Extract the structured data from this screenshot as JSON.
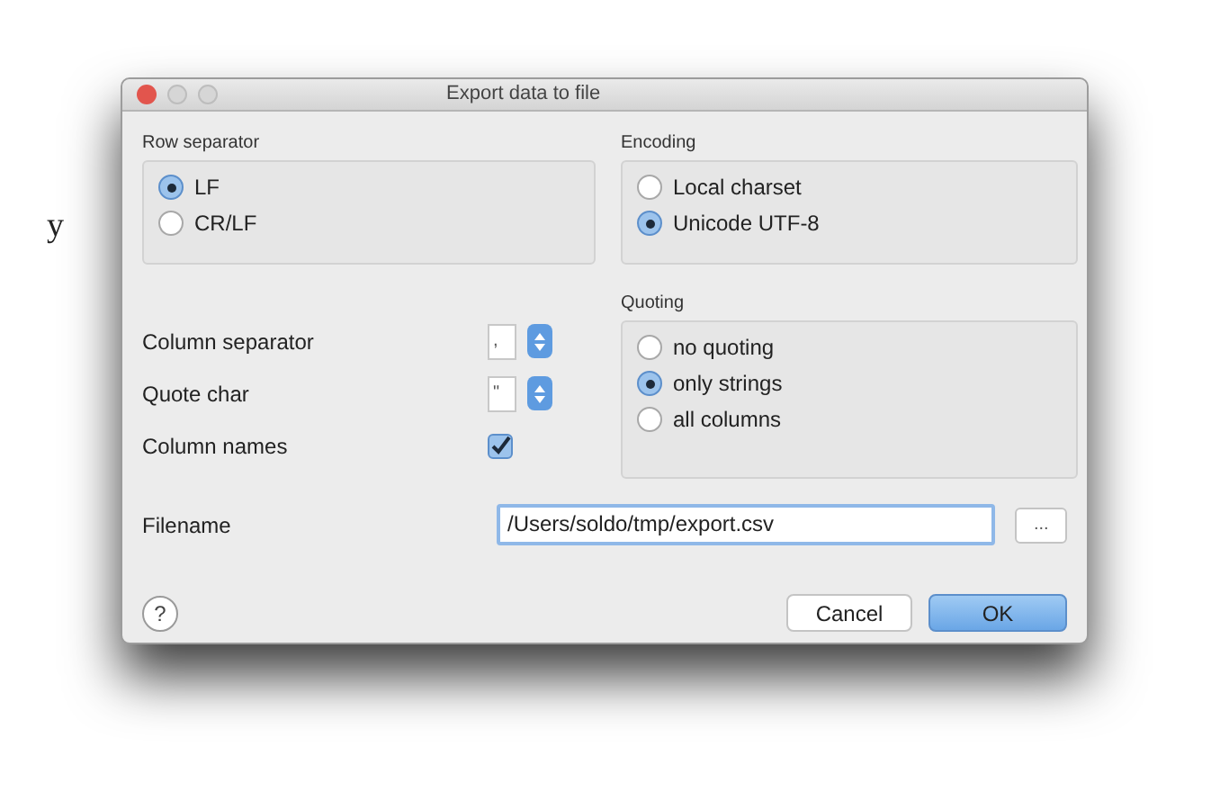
{
  "background_text": "y",
  "window": {
    "title": "Export data to file"
  },
  "row_separator": {
    "label": "Row separator",
    "options": [
      {
        "label": "LF",
        "selected": true
      },
      {
        "label": "CR/LF",
        "selected": false
      }
    ]
  },
  "encoding": {
    "label": "Encoding",
    "options": [
      {
        "label": "Local charset",
        "selected": false
      },
      {
        "label": "Unicode UTF-8",
        "selected": true
      }
    ]
  },
  "column_separator": {
    "label": "Column separator",
    "value": ","
  },
  "quote_char": {
    "label": "Quote char",
    "value": "\""
  },
  "column_names": {
    "label": "Column names",
    "checked": true
  },
  "quoting": {
    "label": "Quoting",
    "options": [
      {
        "label": "no quoting",
        "selected": false
      },
      {
        "label": "only strings",
        "selected": true
      },
      {
        "label": "all columns",
        "selected": false
      }
    ]
  },
  "filename": {
    "label": "Filename",
    "value": "/Users/soldo/tmp/export.csv",
    "browse": "..."
  },
  "help": "?",
  "buttons": [
    {
      "label": "Cancel",
      "kind": "normal"
    },
    {
      "label": "OK",
      "kind": "default"
    }
  ]
}
